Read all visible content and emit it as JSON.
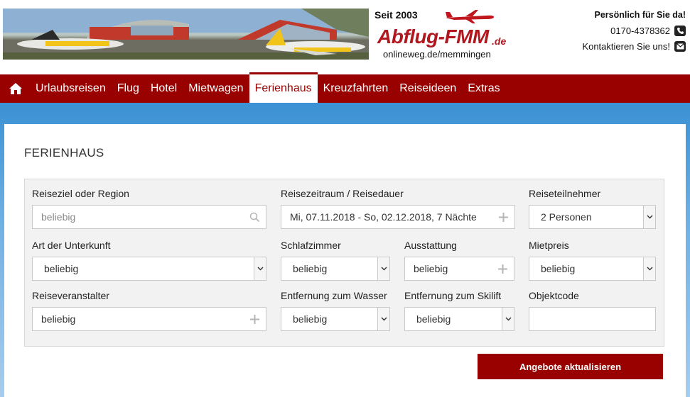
{
  "header": {
    "logo": {
      "since": "Seit 2003",
      "brand": "Abflug-FMM",
      "tld": ".de",
      "url": "onlineweg.de/memmingen"
    },
    "contact": {
      "title": "Persönlich für Sie da!",
      "phone": "0170-4378362",
      "contact_label": "Kontaktieren Sie uns!"
    }
  },
  "nav": {
    "items": [
      "Urlaubsreisen",
      "Flug",
      "Hotel",
      "Mietwagen",
      "Ferienhaus",
      "Kreuzfahrten",
      "Reiseideen",
      "Extras"
    ],
    "active": "Ferienhaus"
  },
  "form": {
    "title": "FERIENHAUS",
    "destination": {
      "label": "Reiseziel oder Region",
      "placeholder": "beliebig"
    },
    "period": {
      "label": "Reisezeitraum / Reisedauer",
      "value": "Mi, 07.11.2018 - So, 02.12.2018, 7 Nächte"
    },
    "travellers": {
      "label": "Reiseteilnehmer",
      "value": "2 Personen"
    },
    "accommodation_type": {
      "label": "Art der Unterkunft",
      "value": "beliebig"
    },
    "bedrooms": {
      "label": "Schlafzimmer",
      "value": "beliebig"
    },
    "features": {
      "label": "Ausstattung",
      "value": "beliebig"
    },
    "rent": {
      "label": "Mietpreis",
      "value": "beliebig"
    },
    "operator": {
      "label": "Reiseveranstalter",
      "value": "beliebig"
    },
    "water_distance": {
      "label": "Entfernung zum Wasser",
      "value": "beliebig"
    },
    "skilift_distance": {
      "label": "Entfernung zum Skilift",
      "value": "beliebig"
    },
    "object_code": {
      "label": "Objektcode",
      "value": ""
    },
    "submit_label": "Angebote aktualisieren"
  }
}
